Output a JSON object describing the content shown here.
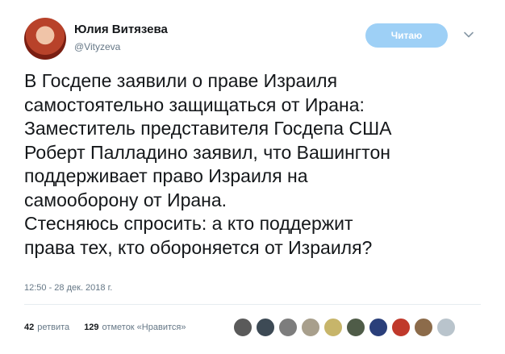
{
  "author": {
    "name": "Юлия Витязева",
    "handle": "@Vityzeva"
  },
  "follow_button": {
    "label": "Читаю"
  },
  "tweet": {
    "lines": [
      "В Госдепе заявили о праве Израиля",
      "самостоятельно защищаться от Ирана:",
      "Заместитель представителя Госдепа США",
      "Роберт Палладино заявил, что Вашингтон",
      "поддерживает право Израиля на",
      "самооборону от Ирана.",
      "Стесняюсь спросить: а кто поддержит",
      "права тех, кто обороняется от Израиля?"
    ],
    "timestamp": "12:50 - 28 дек. 2018 г."
  },
  "stats": {
    "retweets_count": "42",
    "retweets_label": "ретвита",
    "likes_count": "129",
    "likes_label": "отметок «Нравится»"
  },
  "likers": [
    {
      "color": "#5a5a5a"
    },
    {
      "color": "#3d4a55"
    },
    {
      "color": "#7d7d7d"
    },
    {
      "color": "#a89f8c"
    },
    {
      "color": "#c7b56a"
    },
    {
      "color": "#4f5c48"
    },
    {
      "color": "#2a3f7a"
    },
    {
      "color": "#c0392b"
    },
    {
      "color": "#8c6b4a"
    },
    {
      "color": "#b9c4cc"
    }
  ],
  "icons": {
    "chevron": "chevron-down-icon"
  }
}
